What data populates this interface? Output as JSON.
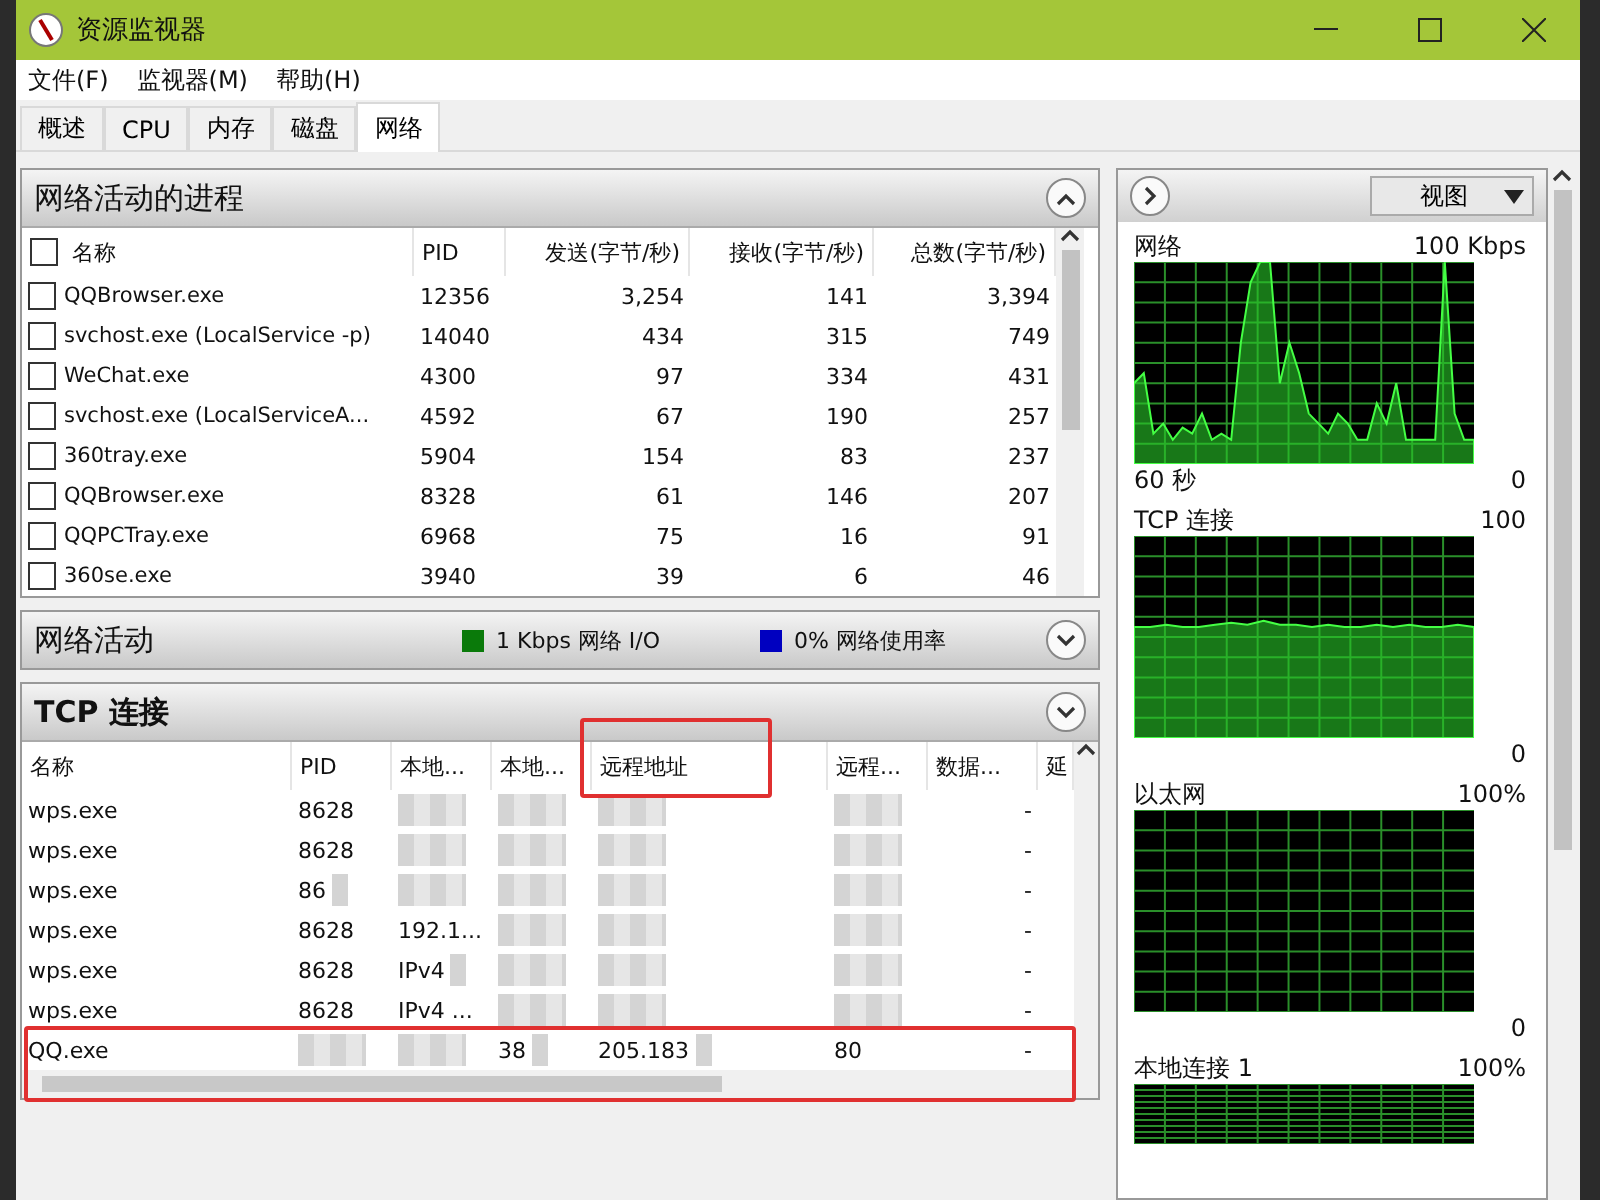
{
  "window": {
    "title": "资源监视器"
  },
  "menu": [
    "文件(F)",
    "监视器(M)",
    "帮助(H)"
  ],
  "tabs": [
    {
      "label": "概述",
      "selected": false
    },
    {
      "label": "CPU",
      "selected": false
    },
    {
      "label": "内存",
      "selected": false
    },
    {
      "label": "磁盘",
      "selected": false
    },
    {
      "label": "网络",
      "selected": true
    }
  ],
  "processes": {
    "title": "网络活动的进程",
    "expanded": true,
    "columns": [
      "名称",
      "PID",
      "发送(字节/秒)",
      "接收(字节/秒)",
      "总数(字节/秒)"
    ],
    "rows": [
      {
        "checked": false,
        "cells": [
          "QQBrowser.exe",
          "12356",
          "3,254",
          "141",
          "3,394"
        ]
      },
      {
        "checked": false,
        "cells": [
          "svchost.exe (LocalService -p)",
          "14040",
          "434",
          "315",
          "749"
        ]
      },
      {
        "checked": false,
        "cells": [
          "WeChat.exe",
          "4300",
          "97",
          "334",
          "431"
        ]
      },
      {
        "checked": false,
        "cells": [
          "svchost.exe (LocalServiceA...",
          "4592",
          "67",
          "190",
          "257"
        ]
      },
      {
        "checked": false,
        "cells": [
          "360tray.exe",
          "5904",
          "154",
          "83",
          "237"
        ]
      },
      {
        "checked": false,
        "cells": [
          "QQBrowser.exe",
          "8328",
          "61",
          "146",
          "207"
        ]
      },
      {
        "checked": false,
        "cells": [
          "QQPCTray.exe",
          "6968",
          "75",
          "16",
          "91"
        ]
      },
      {
        "checked": false,
        "cells": [
          "360se.exe",
          "3940",
          "39",
          "6",
          "46"
        ]
      }
    ]
  },
  "activity": {
    "title": "网络活动",
    "expanded": false,
    "legend": [
      {
        "label": "1 Kbps 网络 I/O",
        "color": "#0a7a0a"
      },
      {
        "label": "0% 网络使用率",
        "color": "#0000c0"
      }
    ]
  },
  "tcp": {
    "title": "TCP 连接",
    "expanded": false,
    "columns": [
      {
        "label": "名称",
        "annotated": false
      },
      {
        "label": "PID",
        "annotated": false
      },
      {
        "label": "本地...",
        "annotated": false
      },
      {
        "label": "本地...",
        "annotated": false
      },
      {
        "label": "远程地址",
        "annotated": true
      },
      {
        "label": "远程...",
        "annotated": false
      },
      {
        "label": "数据...",
        "annotated": false
      },
      {
        "label": "延",
        "annotated": false
      }
    ],
    "rows": [
      {
        "highlighted": false,
        "cells": [
          {
            "text": "wps.exe"
          },
          {
            "text": "8628"
          },
          {
            "blurred": true
          },
          {
            "blurred": true
          },
          {
            "blurred": true
          },
          {
            "blurred": true
          },
          {
            "text": "-"
          },
          {}
        ]
      },
      {
        "highlighted": false,
        "cells": [
          {
            "text": "wps.exe"
          },
          {
            "text": "8628"
          },
          {
            "blurred": true
          },
          {
            "blurred": true
          },
          {
            "blurred": true
          },
          {
            "blurred": true
          },
          {
            "text": "-"
          },
          {}
        ]
      },
      {
        "highlighted": false,
        "cells": [
          {
            "text": "wps.exe"
          },
          {
            "text": "86",
            "blurred": true
          },
          {
            "blurred": true
          },
          {
            "blurred": true
          },
          {
            "blurred": true
          },
          {
            "blurred": true
          },
          {
            "text": "-"
          },
          {}
        ]
      },
      {
        "highlighted": false,
        "cells": [
          {
            "text": "wps.exe"
          },
          {
            "text": "8628"
          },
          {
            "text": "192.1..."
          },
          {
            "blurred": true
          },
          {
            "blurred": true
          },
          {
            "blurred": true
          },
          {
            "text": "-"
          },
          {}
        ]
      },
      {
        "highlighted": false,
        "cells": [
          {
            "text": "wps.exe"
          },
          {
            "text": "8628"
          },
          {
            "text": "IPv4",
            "blurred": true
          },
          {
            "blurred": true
          },
          {
            "blurred": true
          },
          {
            "blurred": true
          },
          {
            "text": "-"
          },
          {}
        ]
      },
      {
        "highlighted": false,
        "cells": [
          {
            "text": "wps.exe"
          },
          {
            "text": "8628"
          },
          {
            "text": "IPv4 ..."
          },
          {
            "blurred": true
          },
          {
            "blurred": true
          },
          {
            "blurred": true
          },
          {
            "text": "-"
          },
          {}
        ]
      },
      {
        "highlighted": true,
        "cells": [
          {
            "text": "QQ.exe"
          },
          {
            "blurred": true
          },
          {
            "blurred": true
          },
          {
            "text": "38",
            "blurred": true
          },
          {
            "text": "205.183",
            "blurred": true
          },
          {
            "text": "80"
          },
          {
            "text": "-"
          },
          {}
        ]
      }
    ]
  },
  "side": {
    "view_button": "视图",
    "graphs": [
      {
        "kind": "spiky",
        "label": "网络",
        "max": "100 Kbps",
        "time": "60 秒",
        "min": "0"
      },
      {
        "kind": "flat",
        "label": "TCP 连接",
        "max": "100",
        "min": "0"
      },
      {
        "kind": "empty",
        "label": "以太网",
        "max": "100%",
        "min": "0"
      },
      {
        "kind": "empty",
        "label": "本地连接 1",
        "max": "100%"
      }
    ]
  }
}
